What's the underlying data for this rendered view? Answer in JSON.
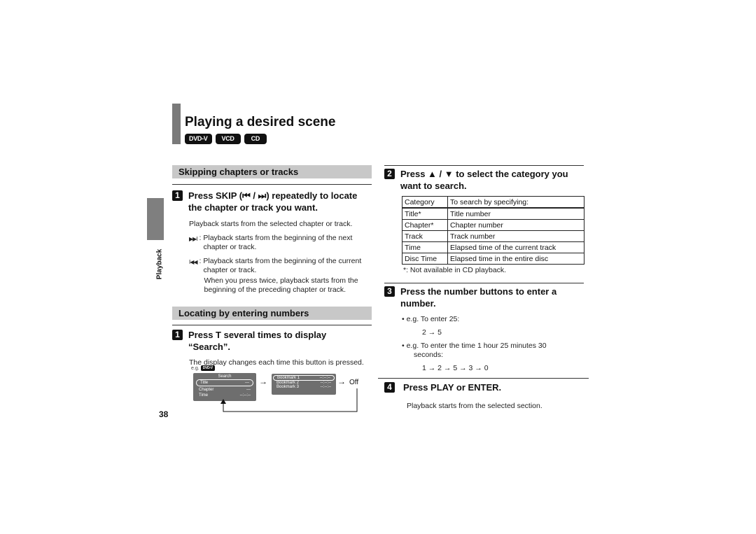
{
  "header": {
    "title": "Playing a desired scene",
    "badges": [
      "DVD-V",
      "VCD",
      "CD"
    ]
  },
  "side_tab": {
    "label": "Playback"
  },
  "page_number": "38",
  "skip_section": {
    "heading": "Skipping chapters or tracks",
    "step_num": "1",
    "step_text_1": "Press SKIP (⏮ / ⏭) repeatedly to locate",
    "step_text_2": "the chapter or track you want.",
    "intro": "Playback starts from the selected chapter or track.",
    "next_icon": "skip-next-icon",
    "next_symbol": "▶▶I",
    "next_text_1": ": Playback starts from the beginning of the next",
    "next_text_2": "chapter or track.",
    "prev_icon": "skip-prev-icon",
    "prev_symbol": "I◀◀",
    "prev_text_1": ": Playback starts from the beginning of the current",
    "prev_text_2": "chapter or track.",
    "twice_1": "When you press twice, playback starts from the",
    "twice_2": "beginning of the preceding chapter or track."
  },
  "locate_section": {
    "heading": "Locating by entering numbers",
    "step_num": "1",
    "step_text_1": "Press T several times to display",
    "step_text_2": "“Search”.",
    "body": "The display changes each time this button is pressed.",
    "eg": "e.g.",
    "eg_badge": "DVD-V",
    "osd1": {
      "title": "Search",
      "rows": [
        {
          "label": "Title",
          "value": "---"
        },
        {
          "label": "Chapter",
          "value": "---"
        },
        {
          "label": "Time",
          "value": "--:--:--"
        }
      ]
    },
    "osd2": {
      "rows": [
        {
          "label": "Bookmark 1",
          "value": "--:--:--"
        },
        {
          "label": "Bookmark 2",
          "value": "--:--:--"
        },
        {
          "label": "Bookmark 3",
          "value": "--:--:--"
        }
      ]
    },
    "arrow": "→",
    "off_label": "Off"
  },
  "step2": {
    "num": "2",
    "text_1": "Press ▲ / ▼ to select the category you",
    "text_2": "want to search.",
    "table": {
      "headers": [
        "Category",
        "To search by specifying:"
      ],
      "rows": [
        [
          "Title*",
          "Title number"
        ],
        [
          "Chapter*",
          "Chapter number"
        ],
        [
          "Track",
          "Track number"
        ],
        [
          "Time",
          "Elapsed time of the current track"
        ],
        [
          "Disc Time",
          "Elapsed time in the entire disc"
        ]
      ]
    },
    "note": "*: Not available in CD playback."
  },
  "step3": {
    "num": "3",
    "text_1": "Press the number buttons to enter a",
    "text_2": "number.",
    "eg1": "e.g. To enter 25:",
    "seq1": "2 → 5",
    "eg2_1": "e.g. To enter the time 1 hour 25 minutes 30",
    "eg2_2": "seconds:",
    "seq2": "1 → 2 → 5 → 3 → 0"
  },
  "step4": {
    "num": "4",
    "text": "Press PLAY or ENTER.",
    "body": "Playback starts from the selected section."
  }
}
